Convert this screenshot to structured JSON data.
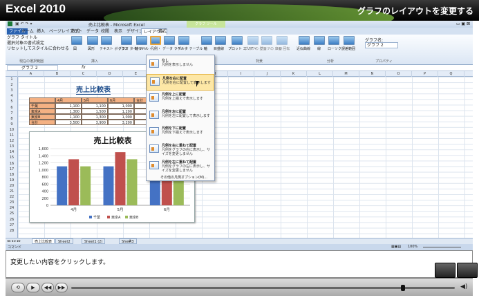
{
  "banner": {
    "title": "Excel 2010",
    "lesson": "グラフのレイアウトを変更する"
  },
  "titlebar": {
    "doc": "売上比較表 - Microsoft Excel",
    "context_tab": "グラフ ツール",
    "controls": "▭ ▣ ⊠"
  },
  "ribbon_tabs": [
    "ファイル",
    "ホーム",
    "挿入",
    "ページレイアウト",
    "数式",
    "データ",
    "校閲",
    "表示",
    "デザイン",
    "レイアウト",
    "書式"
  ],
  "ribbon": {
    "selection_items": [
      "グラフ タイトル",
      "選択対象の書式設定",
      "リセットしてスタイルに合わせる"
    ],
    "group_selection": "現在の選択範囲",
    "insert_buttons": [
      "図",
      "図形",
      "テキスト ボックス"
    ],
    "group_insert": "挿入",
    "label_buttons": [
      "グラフ タイトル・",
      "軸ラベル・",
      "凡例・",
      "データ ラベル・",
      "データ テーブル・"
    ],
    "axis_buttons": [
      "軸",
      "目盛線",
      "プロット エリア・",
      "グラフの 壁面・",
      "グラフの 床面・",
      "3-D 回転"
    ],
    "group_bg": "背景",
    "analysis_buttons": [
      "近似曲線",
      "線",
      "ローソク",
      "誤差範囲"
    ],
    "group_analysis": "分析",
    "chart_name_label": "グラフ名:",
    "chart_name": "グラフ 2",
    "group_property": "プロパティ"
  },
  "formula": {
    "name_box": "グラフ 2",
    "fx": "fx"
  },
  "columns": [
    "A",
    "B",
    "C",
    "D",
    "E",
    "F",
    "G",
    "H",
    "I",
    "J",
    "K",
    "L",
    "M",
    "N",
    "O",
    "P",
    "Q",
    "R",
    "S"
  ],
  "rows": [
    "1",
    "2",
    "3",
    "4",
    "5",
    "6",
    "7",
    "8",
    "9",
    "10",
    "11",
    "12",
    "13",
    "14",
    "15",
    "16",
    "17",
    "18",
    "19",
    "20",
    "21",
    "22",
    "23",
    "24",
    "25",
    "26",
    "27",
    "28"
  ],
  "sheet": {
    "title": "売上比較表",
    "header": [
      "",
      "4月",
      "5月",
      "6月",
      "合計"
    ],
    "table": [
      [
        "千葉",
        "1,100",
        "1,100",
        "1,000",
        "3,200"
      ],
      [
        "東京A",
        "1,300",
        "1,500",
        "1,200",
        "4,000"
      ],
      [
        "東京B",
        "1,100",
        "1,300",
        "1,000",
        "3,400"
      ],
      [
        "合計",
        "3,500",
        "3,900",
        "3,200",
        "10,600"
      ]
    ]
  },
  "chart_data": {
    "type": "bar",
    "title": "売上比較表",
    "categories": [
      "4月",
      "5月",
      "6月"
    ],
    "series": [
      {
        "name": "千葉",
        "values": [
          1100,
          1100,
          1000
        ],
        "color": "#4472c4"
      },
      {
        "name": "東京A",
        "values": [
          1300,
          1500,
          1200
        ],
        "color": "#c0504d"
      },
      {
        "name": "東京B",
        "values": [
          1100,
          1300,
          1000
        ],
        "color": "#9bbb59"
      }
    ],
    "ylim": [
      0,
      1600
    ],
    "yticks": [
      "0",
      "200",
      "400",
      "600",
      "800",
      "1,000",
      "1,200",
      "1,400",
      "1,600"
    ],
    "grid": true,
    "legend": "bottom"
  },
  "dropdown": {
    "items": [
      {
        "title": "なし",
        "desc": "凡例を表示しません"
      },
      {
        "title": "凡例を右に配置",
        "desc": "凡例を右に配置して表示します"
      },
      {
        "title": "凡例を上に配置",
        "desc": "凡例を上揃えで表示します"
      },
      {
        "title": "凡例を左に配置",
        "desc": "凡例を左に配置して表示します"
      },
      {
        "title": "凡例を下に配置",
        "desc": "凡例を下揃えで表示します"
      },
      {
        "title": "凡例を右に重ねて配置",
        "desc": "凡例をグラフの右に表示し、サイズを変更しません"
      },
      {
        "title": "凡例を左に重ねて配置",
        "desc": "凡例をグラフの左に表示し、サイズを変更しません"
      }
    ],
    "more": "その他の凡例オプション(M)..."
  },
  "sheet_tabs": [
    "売上比較表",
    "Sheet2",
    "Sheet1 (2)",
    "Sheet3"
  ],
  "status": {
    "mode": "コマンド",
    "zoom": "100%"
  },
  "instruction": "変更したい内容をクリックします。",
  "player": {
    "buttons": [
      "⟲",
      "▶",
      "◀◀",
      "▶▶"
    ],
    "progress": 0.87
  }
}
